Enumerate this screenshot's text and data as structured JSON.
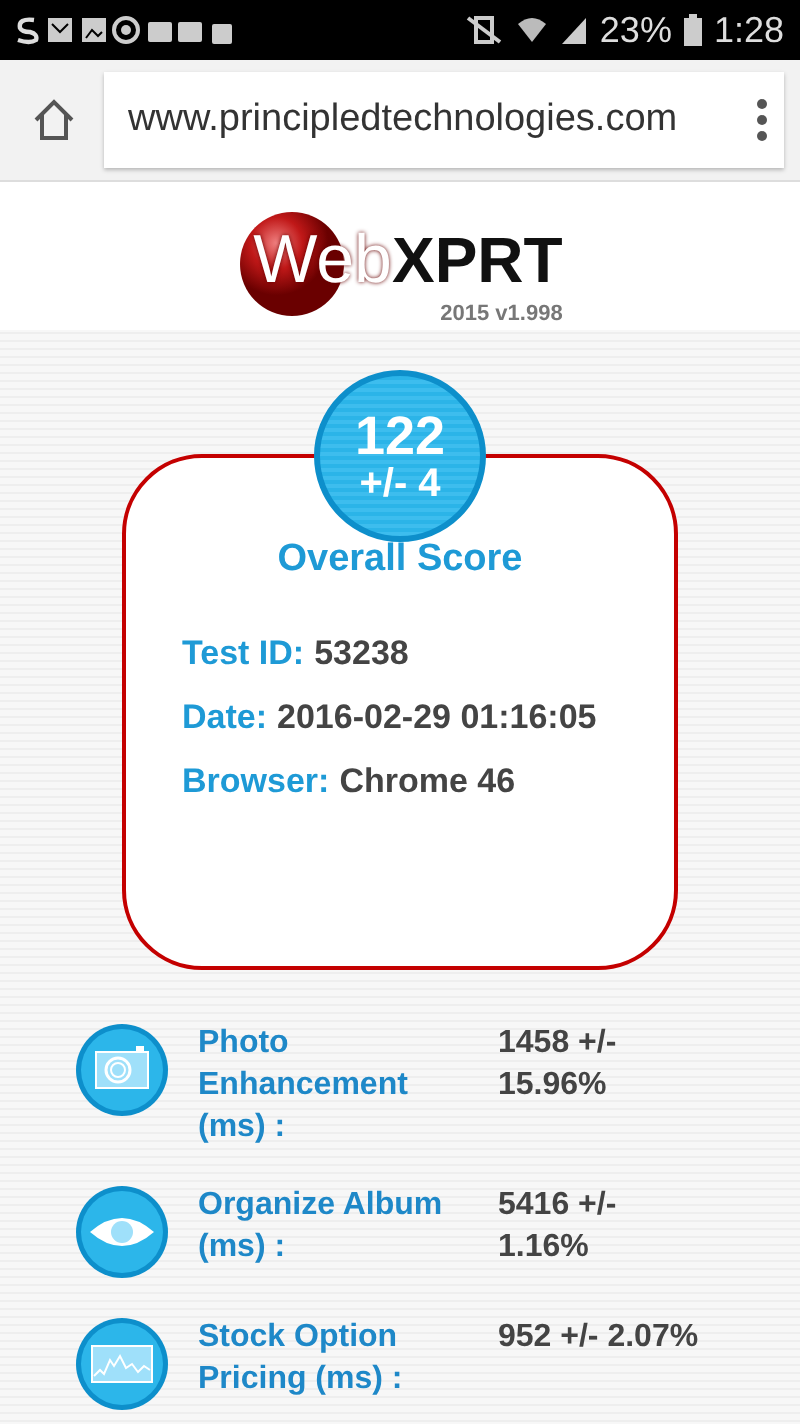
{
  "status_bar": {
    "battery": "23%",
    "time": "1:28"
  },
  "browser": {
    "url": "www.principledtechnologies.com"
  },
  "logo": {
    "name_left": "Web",
    "name_right": "XPRT",
    "version": "2015 v1.998"
  },
  "score": {
    "value": "122",
    "margin": "+/- 4",
    "title": "Overall Score"
  },
  "details": [
    {
      "label": "Test ID:",
      "value": "53238"
    },
    {
      "label": "Date:",
      "value": "2016-02-29 01:16:05"
    },
    {
      "label": "Browser:",
      "value": "Chrome 46"
    }
  ],
  "metrics": [
    {
      "kind": "camera",
      "label": "Photo Enhancement (ms) :",
      "value": "1458 +/- 15.96%"
    },
    {
      "kind": "eye",
      "label": "Organize Album (ms) :",
      "value": "5416 +/- 1.16%"
    },
    {
      "kind": "chart",
      "label": "Stock Option Pricing (ms) :",
      "value": "952 +/- 2.07%"
    }
  ]
}
